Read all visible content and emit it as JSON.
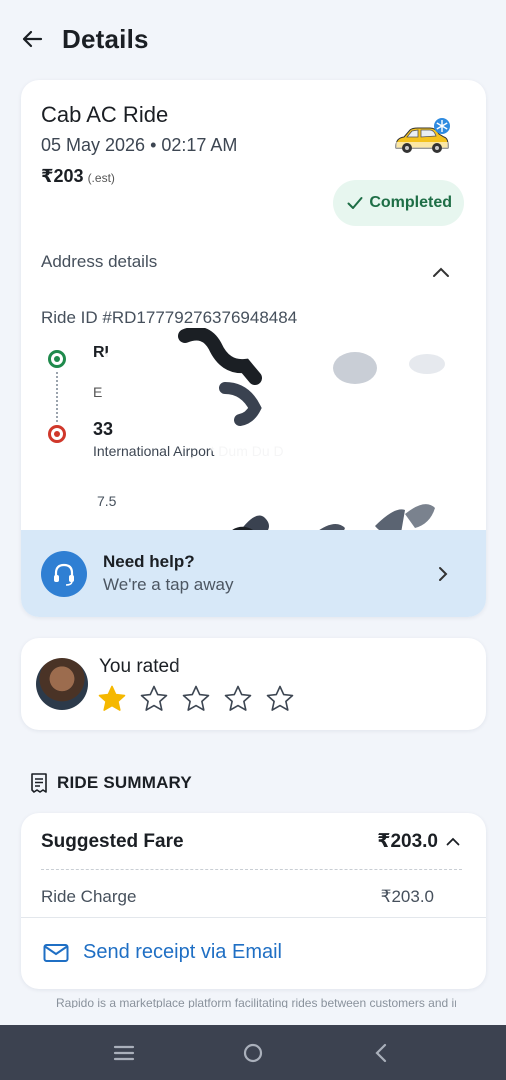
{
  "header": {
    "title": "Details"
  },
  "ride": {
    "title": "Cab AC Ride",
    "datetime": "05 May 2026 • 02:17 AM",
    "fare": "₹203",
    "fare_note": "(.est)",
    "status": "Completed",
    "address_header": "Address details",
    "ride_id": "Ride ID #RD17779276376948484",
    "pickup": {
      "name": "RI",
      "subtext": "E"
    },
    "drop": {
      "name": "33",
      "address": "International Airport Dum Du D"
    },
    "distance": "7.5"
  },
  "help": {
    "title": "Need help?",
    "subtitle": "We're a tap away"
  },
  "rating": {
    "label": "You rated",
    "stars_filled": 1,
    "stars_total": 5
  },
  "summary": {
    "title": "RIDE SUMMARY",
    "suggested_fare_label": "Suggested Fare",
    "suggested_fare_value": "₹203.0",
    "ride_charge_label": "Ride Charge",
    "ride_charge_value": "₹203.0",
    "email_label": "Send receipt via Email"
  },
  "footnote": "Rapido is a marketplace platform facilitating rides between customers and independent captains",
  "colors": {
    "status_green": "#1e6e46",
    "help_blue": "#2f7fd3",
    "link_blue": "#1f6fc4",
    "star": "#f5b800"
  }
}
